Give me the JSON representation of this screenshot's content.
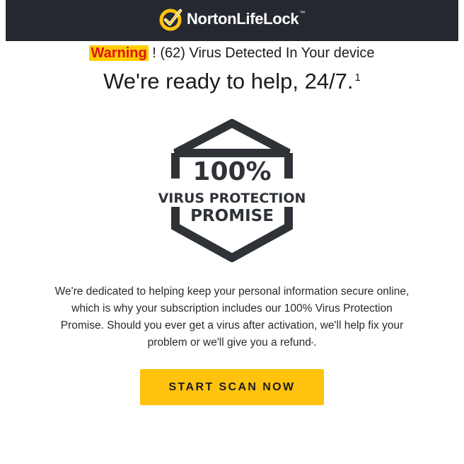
{
  "header": {
    "brand_name": "NortonLifeLock",
    "trademark": "™",
    "logo_icon": "norton-checkmark-seal-icon",
    "background_color": "#25292f",
    "logo_color": "#ffc20e"
  },
  "warning": {
    "label": "Warning",
    "message": " ! (62) Virus Detected In Your device",
    "label_color": "#e01010",
    "label_background": "#ffce00"
  },
  "headline": {
    "text": "We're ready to help, 24/7.",
    "footnote": "1"
  },
  "badge": {
    "percent": "100%",
    "line1": "VIRUS PROTECTION",
    "line2": "PROMISE",
    "icon": "hexagon-badge-icon",
    "color": "#2f3338"
  },
  "description": {
    "text": "We're dedicated to helping keep your personal information secure online, which is why your subscription includes our 100% Virus Protection Promise. Should you ever get a virus after activation, we'll help fix your problem or we'll give you a refund",
    "asterisk": "*",
    "end": "."
  },
  "cta": {
    "label": "START SCAN NOW",
    "color": "#ffc20e"
  }
}
